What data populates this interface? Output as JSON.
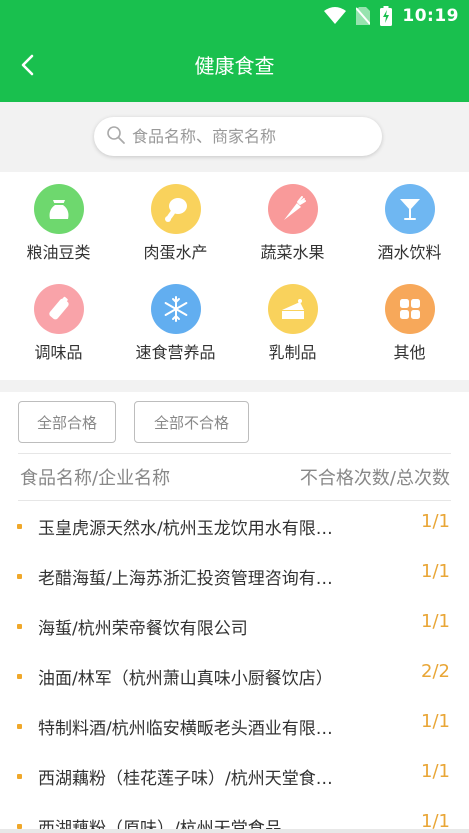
{
  "status_bar": {
    "time": "10:19"
  },
  "header": {
    "title": "健康食查"
  },
  "search": {
    "placeholder": "食品名称、商家名称"
  },
  "categories": [
    {
      "label": "粮油豆类",
      "icon": "grain-sack-icon",
      "color": "#6ed86e"
    },
    {
      "label": "肉蛋水产",
      "icon": "drumstick-icon",
      "color": "#f9d25c"
    },
    {
      "label": "蔬菜水果",
      "icon": "carrot-icon",
      "color": "#f99a9a"
    },
    {
      "label": "酒水饮料",
      "icon": "cocktail-glass-icon",
      "color": "#6fb7f2"
    },
    {
      "label": "调味品",
      "icon": "seasoning-bottle-icon",
      "color": "#f9a3a9"
    },
    {
      "label": "速食营养品",
      "icon": "snowflake-icon",
      "color": "#62aef0"
    },
    {
      "label": "乳制品",
      "icon": "cake-slice-icon",
      "color": "#f9d25c"
    },
    {
      "label": "其他",
      "icon": "grid-icon",
      "color": "#f7a85a"
    }
  ],
  "filters": {
    "all_pass": "全部合格",
    "all_fail": "全部不合格"
  },
  "table": {
    "col_name": "食品名称/企业名称",
    "col_count": "不合格次数/总次数",
    "rows": [
      {
        "name": "玉皇虎源天然水/杭州玉龙饮用水有限公司",
        "count": "1/1"
      },
      {
        "name": "老醋海蜇/上海苏浙汇投资管理咨询有限公司",
        "count": "1/1"
      },
      {
        "name": "海蜇/杭州荣帝餐饮有限公司",
        "count": "1/1"
      },
      {
        "name": "油面/林军（杭州萧山真味小厨餐饮店）",
        "count": "2/2"
      },
      {
        "name": "特制料酒/杭州临安横畈老头酒业有限公司",
        "count": "1/1"
      },
      {
        "name": "西湖藕粉（桂花莲子味）/杭州天堂食品有限公司",
        "count": "1/1"
      },
      {
        "name": "西湖藕粉（原味）/杭州天堂食品",
        "count": "1/1"
      }
    ]
  },
  "colors": {
    "accent": "#19c04e",
    "count": "#e9a636"
  }
}
